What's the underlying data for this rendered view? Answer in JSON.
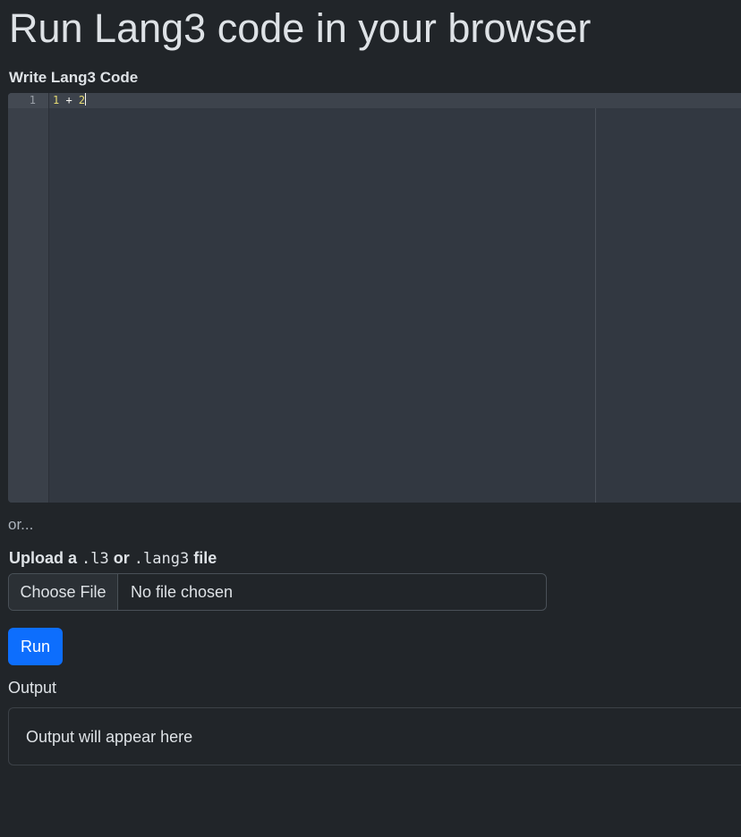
{
  "page": {
    "title": "Run Lang3 code in your browser"
  },
  "editor": {
    "label": "Write Lang3 Code",
    "lines": [
      {
        "number": "1",
        "tokens": [
          {
            "text": "1",
            "kind": "number"
          },
          {
            "text": " + ",
            "kind": "operator"
          },
          {
            "text": "2",
            "kind": "number"
          }
        ]
      }
    ],
    "colors": {
      "background": "#323841",
      "gutter": "#3a4049",
      "number": "#e6db74",
      "operator": "#f8f8f2"
    }
  },
  "separator": {
    "text": "or..."
  },
  "upload": {
    "label_prefix": "Upload a",
    "ext_1": ".l3",
    "label_middle": "or",
    "ext_2": ".lang3",
    "label_suffix": "file",
    "button_label": "Choose File",
    "status": "No file chosen"
  },
  "run": {
    "label": "Run",
    "color": "#0d6efd"
  },
  "output": {
    "label": "Output",
    "placeholder": "Output will appear here"
  },
  "theme": {
    "background": "#212529",
    "text": "#dee2e6"
  }
}
